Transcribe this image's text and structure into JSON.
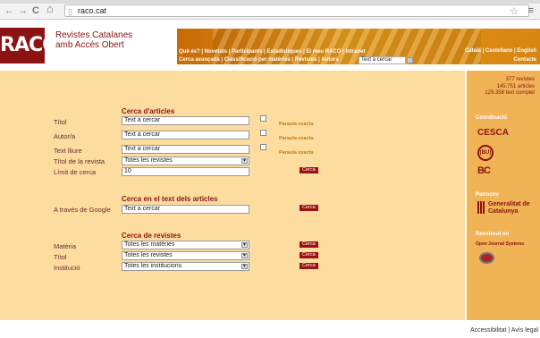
{
  "browser": {
    "url": "raco.cat",
    "back_icon": "←",
    "forward_icon": "→",
    "reload_icon": "C",
    "home_icon": "⌂",
    "star_icon": "☆",
    "menu_icon": "≡"
  },
  "header": {
    "logo": "RACO",
    "brand_line1": "Revistes Catalanes",
    "brand_line2": "amb Accés Obert",
    "topnav": "Què és? | Novetats | Participants | Estadístiques | El meu RACO | Intranet",
    "subnav": "Cerca avançada | Classificació per matèries | Revistes | Autors",
    "search_value": "Text a cercar",
    "lang": "Català | Castellano | English",
    "contact": "Contacte"
  },
  "articles": {
    "title": "Cerca d'articles",
    "fields": [
      {
        "label": "Títol",
        "value": "Text a cercar",
        "exact": "Paraula exacta"
      },
      {
        "label": "Autor/a",
        "value": "Text a cercar",
        "exact": "Paraula exacta"
      },
      {
        "label": "Text lliure",
        "value": "Text a cercar",
        "exact": "Paraula exacta"
      }
    ],
    "journal_label": "Títol de la revista",
    "journal_value": "Totes les revistes",
    "limit_label": "Límit de cerca",
    "limit_value": "10",
    "button": "Cerca"
  },
  "fulltext": {
    "title": "Cerca en el text dels articles",
    "label": "A través de Google",
    "value": "Text a cercar",
    "button": "Cerca"
  },
  "journals": {
    "title": "Cerca de revistes",
    "rows": [
      {
        "label": "Matèria",
        "value": "Totes les matèries",
        "button": "Cerca"
      },
      {
        "label": "Títol",
        "value": "Totes les revistes",
        "button": "Cerca"
      },
      {
        "label": "Institució",
        "value": "Totes les institucions",
        "button": "Cerca"
      }
    ]
  },
  "sidebar": {
    "stat1": "377 revistes",
    "stat2": "145.751 articles",
    "stat3": "129.358 text complet",
    "coord_title": "Coordinació",
    "coord1": "CESCA",
    "coord2": "(BU)",
    "coord3": "BC",
    "partner_title": "Patrocini",
    "partner": "Generalitat de Catalunya",
    "harvest_title": "Recolecat en",
    "harvest": "Open Journal Systems"
  },
  "footer": "Accessibilitat | Avís legal",
  "colors": {
    "brand": "#8c1313",
    "band": "#d98a14",
    "main_bg": "#fcdd9f",
    "side_bg": "#f0b356"
  }
}
